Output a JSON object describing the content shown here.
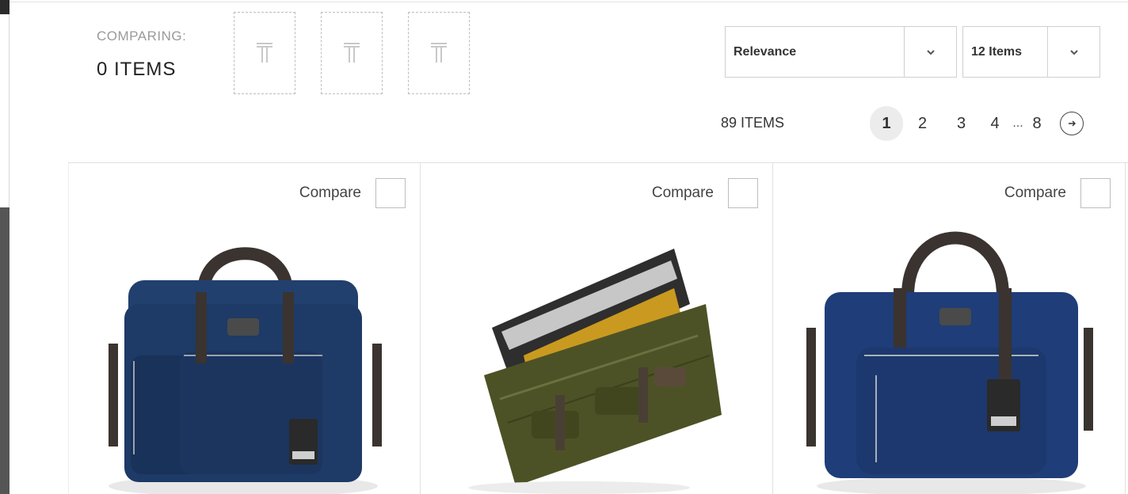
{
  "compare": {
    "label": "COMPARING:",
    "count": "0  ITEMS",
    "slot_icon": "tumi-t-icon"
  },
  "sort": {
    "selected": "Relevance"
  },
  "per_page": {
    "selected": "12 Items"
  },
  "results": {
    "total": "89 ITEMS"
  },
  "pagination": {
    "current": "1",
    "pages": [
      "2",
      "3",
      "4"
    ],
    "ellipsis": "...",
    "last": "8"
  },
  "products": [
    {
      "compare_label": "Compare",
      "color": "#1e3a66"
    },
    {
      "compare_label": "Compare",
      "color": "#4d5226"
    },
    {
      "compare_label": "Compare",
      "color": "#1f3d78"
    }
  ],
  "colors": {
    "left_bar": "#555555",
    "current_page_bg": "#ececec"
  }
}
